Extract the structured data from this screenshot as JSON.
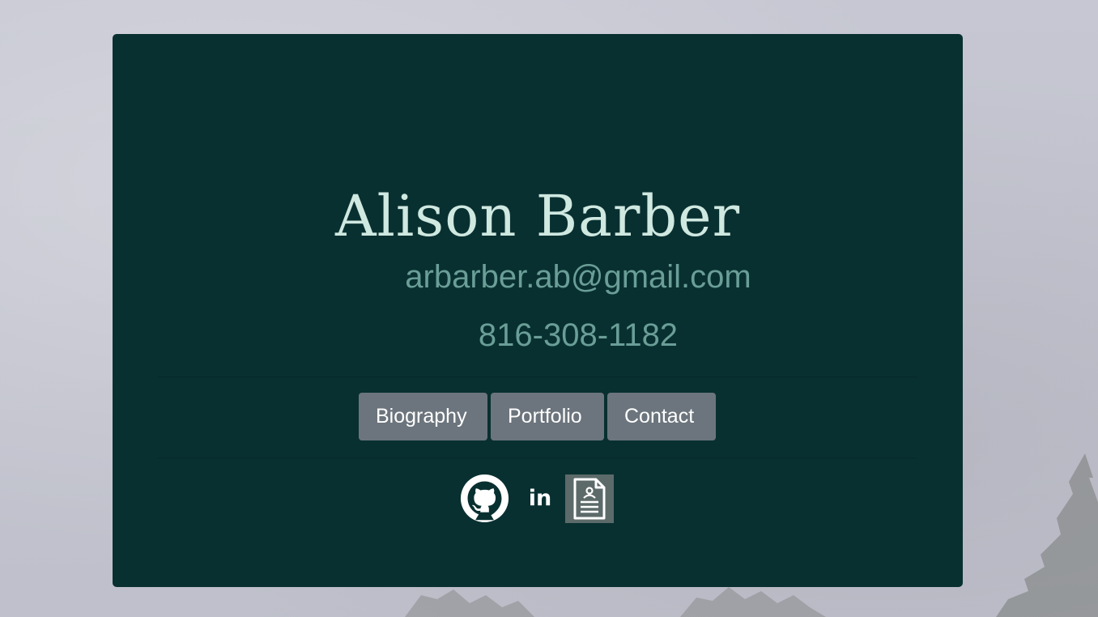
{
  "profile": {
    "name": "Alison Barber",
    "email": "arbarber.ab@gmail.com",
    "phone": "816-308-1182"
  },
  "nav": {
    "biography_label": "Biography",
    "portfolio_label": "Portfolio",
    "contact_label": "Contact"
  },
  "socials": {
    "github_icon": "github-icon",
    "linkedin_label": "in",
    "resume_icon": "resume-document-icon"
  },
  "colors": {
    "card_background": "#093031",
    "name_text": "#cfe8e0",
    "contact_text": "#6a9e97",
    "button_background": "#6c757d",
    "page_background": "#c3c4cf"
  }
}
